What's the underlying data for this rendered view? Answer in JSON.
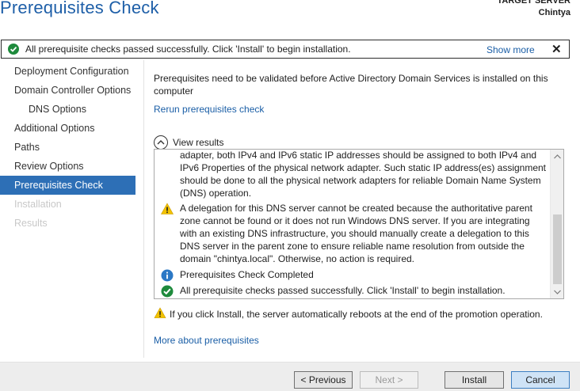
{
  "header": {
    "title": "Prerequisites Check",
    "target_label": "TARGET SERVER",
    "target_name": "Chintya"
  },
  "notification": {
    "text": "All prerequisite checks passed successfully.  Click 'Install' to begin installation.",
    "show_more": "Show more",
    "close": "✕"
  },
  "sidebar": {
    "items": [
      {
        "label": "Deployment Configuration",
        "state": "normal"
      },
      {
        "label": "Domain Controller Options",
        "state": "normal"
      },
      {
        "label": "DNS Options",
        "state": "indent"
      },
      {
        "label": "Additional Options",
        "state": "normal"
      },
      {
        "label": "Paths",
        "state": "normal"
      },
      {
        "label": "Review Options",
        "state": "normal"
      },
      {
        "label": "Prerequisites Check",
        "state": "active"
      },
      {
        "label": "Installation",
        "state": "disabled"
      },
      {
        "label": "Results",
        "state": "disabled"
      }
    ]
  },
  "main": {
    "intro": "Prerequisites need to be validated before Active Directory Domain Services is installed on this computer",
    "rerun_link": "Rerun prerequisites check",
    "view_results": "View results",
    "results": [
      {
        "icon": "none",
        "text": "adapter, both IPv4 and IPv6 static IP addresses should be assigned to both IPv4 and IPv6 Properties of the physical network adapter. Such static IP address(es) assignment should be done to all the physical network adapters for reliable Domain Name System (DNS) operation."
      },
      {
        "icon": "warning-icon",
        "text": "A delegation for this DNS server cannot be created because the authoritative parent zone cannot be found or it does not run Windows DNS server. If you are integrating with an existing DNS infrastructure, you should manually create a delegation to this DNS server in the parent zone to ensure reliable name resolution from outside the domain \"chintya.local\". Otherwise, no action is required."
      },
      {
        "icon": "info-icon",
        "text": "Prerequisites Check Completed"
      },
      {
        "icon": "success-icon",
        "text": "All prerequisite checks passed successfully.  Click 'Install' to begin installation."
      }
    ],
    "reboot_warning": "If you click Install, the server automatically reboots at the end of the promotion operation.",
    "more_link": "More about prerequisites"
  },
  "footer": {
    "previous": "< Previous",
    "next": "Next >",
    "install": "Install",
    "cancel": "Cancel"
  },
  "colors": {
    "accent": "#2d6fb6",
    "link": "#1a5ea6",
    "success": "#1e8a3c",
    "warning": "#f2c200",
    "info": "#2b78c5"
  }
}
